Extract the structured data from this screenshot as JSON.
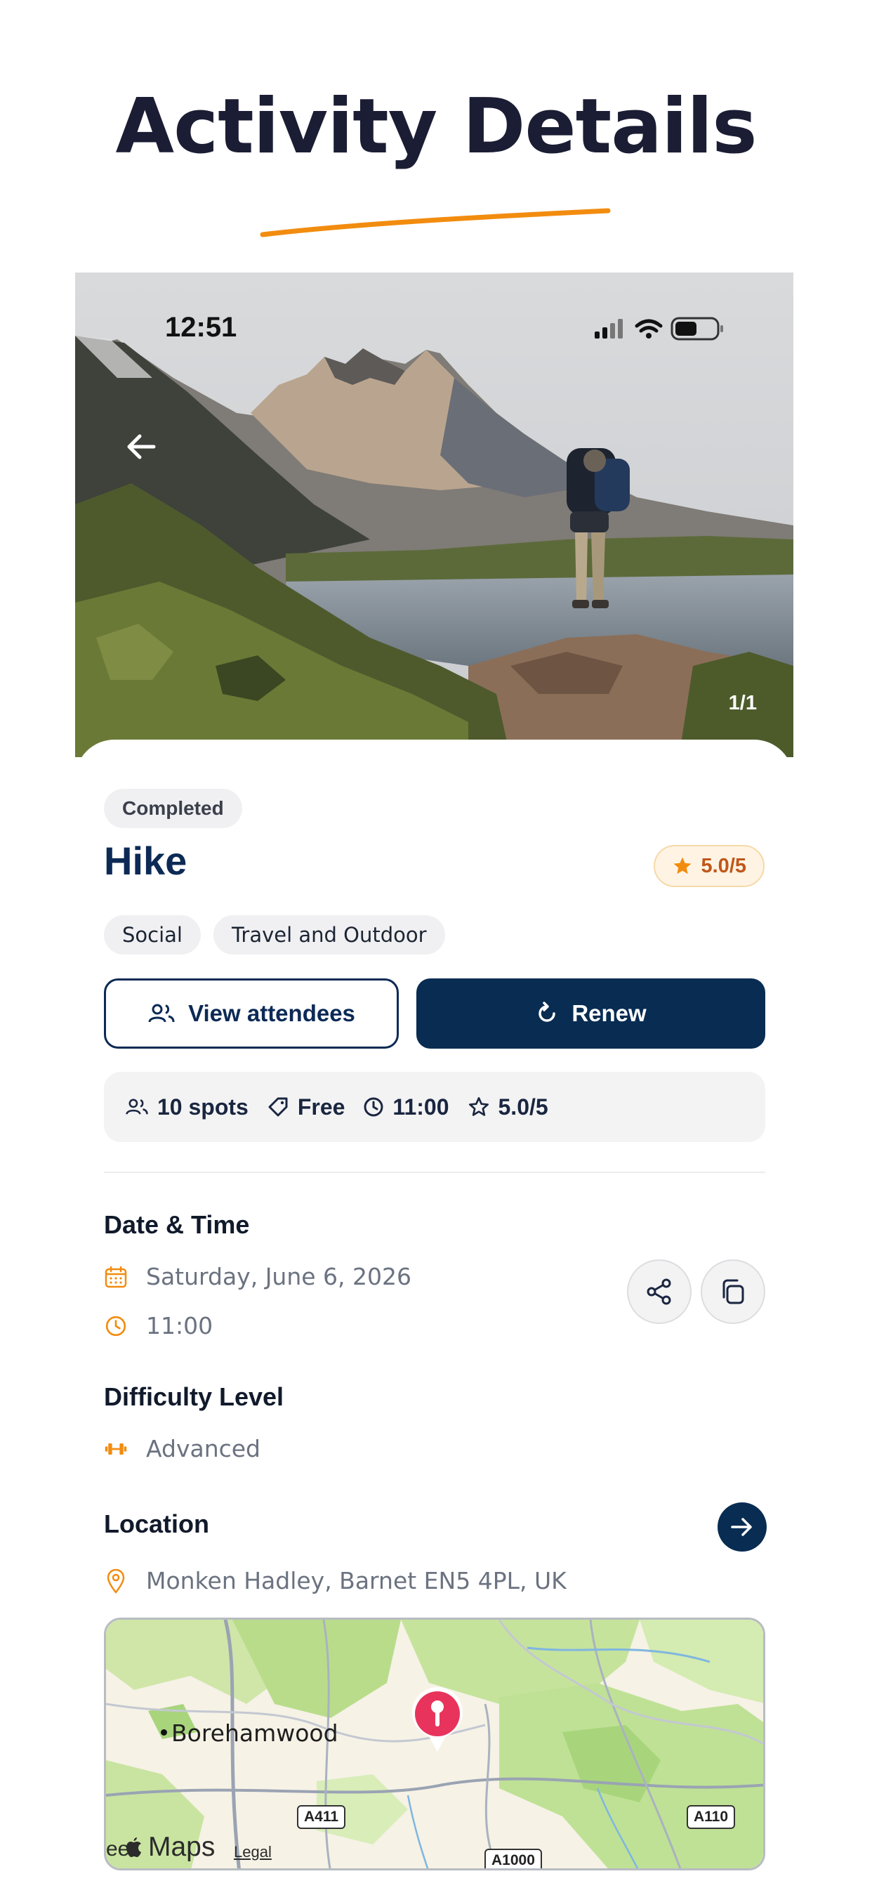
{
  "page": {
    "title": "Activity Details",
    "accent_color": "#F28C0F"
  },
  "status_bar": {
    "time": "12:51"
  },
  "hero": {
    "photo_counter": "1/1",
    "back_icon": "arrow-left-icon"
  },
  "activity": {
    "status": "Completed",
    "name": "Hike",
    "rating": "5.0/5",
    "tags": [
      "Social",
      "Travel and Outdoor"
    ]
  },
  "actions": {
    "view_attendees_label": "View attendees",
    "renew_label": "Renew"
  },
  "info_strip": {
    "spots": "10 spots",
    "price": "Free",
    "time": "11:00",
    "rating": "5.0/5"
  },
  "date_time": {
    "heading": "Date & Time",
    "date": "Saturday, June 6, 2026",
    "time": "11:00"
  },
  "difficulty": {
    "heading": "Difficulty Level",
    "value": "Advanced"
  },
  "location": {
    "heading": "Location",
    "address": "Monken Hadley, Barnet EN5 4PL, UK"
  },
  "map": {
    "town": "Borehamwood",
    "roads": [
      "A411",
      "A1000",
      "A110"
    ],
    "brand": "Maps",
    "legal": "Legal",
    "partial_label": "ee"
  },
  "colors": {
    "navy": "#082C52",
    "orange": "#F28C0F",
    "rating_text": "#C0571A"
  }
}
